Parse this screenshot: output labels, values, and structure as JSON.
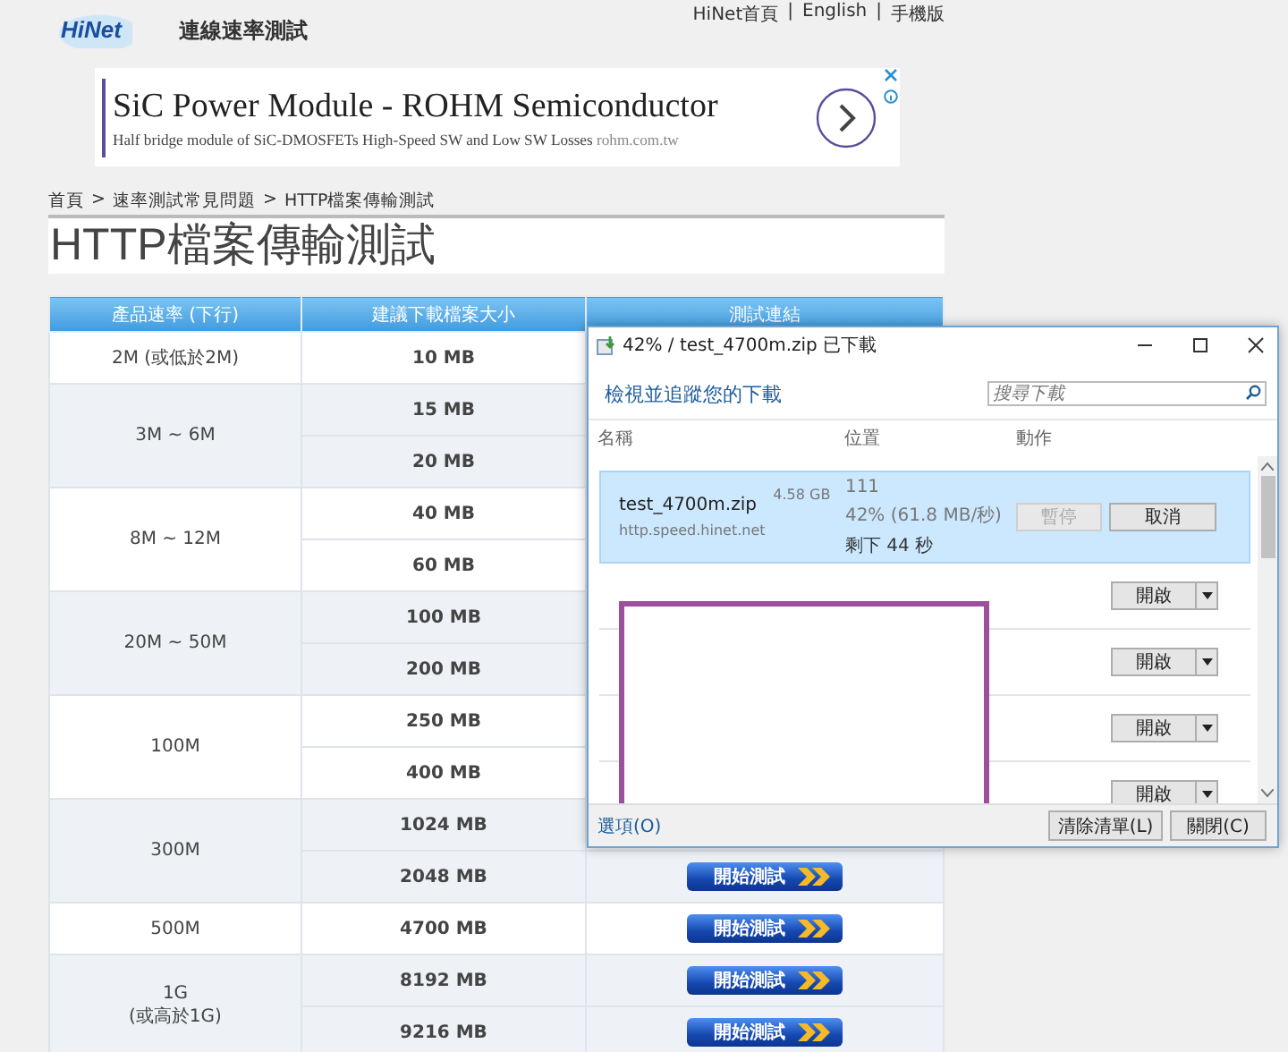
{
  "header": {
    "logo": "HiNet",
    "title": "連線速率測試",
    "links": [
      "HiNet首頁",
      "English",
      "手機版"
    ],
    "separator": "|"
  },
  "ad": {
    "title": "SiC Power Module - ROHM Semiconductor",
    "description": "Half bridge module of SiC-DMOSFETs High-Speed SW and Low SW Losses",
    "domain": "rohm.com.tw"
  },
  "breadcrumb": {
    "items": [
      "首頁",
      "速率測試常見問題",
      "HTTP檔案傳輸測試"
    ],
    "separator": ">"
  },
  "page_title": "HTTP檔案傳輸測試",
  "table": {
    "columns": [
      "產品速率 (下行)",
      "建議下載檔案大小",
      "測試連結"
    ],
    "groups": [
      {
        "speed": "2M (或低於2M)",
        "sizes": [
          {
            "size": "10 MB"
          }
        ]
      },
      {
        "speed": "3M ~ 6M",
        "sizes": [
          {
            "size": "15 MB"
          },
          {
            "size": "20 MB"
          }
        ]
      },
      {
        "speed": "8M ~ 12M",
        "sizes": [
          {
            "size": "40 MB"
          },
          {
            "size": "60 MB"
          }
        ]
      },
      {
        "speed": "20M ~ 50M",
        "sizes": [
          {
            "size": "100 MB"
          },
          {
            "size": "200 MB"
          }
        ]
      },
      {
        "speed": "100M",
        "sizes": [
          {
            "size": "250 MB"
          },
          {
            "size": "400 MB"
          }
        ]
      },
      {
        "speed": "300M",
        "sizes": [
          {
            "size": "1024 MB"
          },
          {
            "size": "2048 MB",
            "button": "開始測試"
          }
        ]
      },
      {
        "speed": "500M",
        "sizes": [
          {
            "size": "4700 MB",
            "button": "開始測試"
          }
        ]
      },
      {
        "speed": "1G\n(或高於1G)",
        "sizes": [
          {
            "size": "8192 MB",
            "button": "開始測試"
          },
          {
            "size": "9216 MB",
            "button": "開始測試"
          }
        ]
      }
    ]
  },
  "download_dialog": {
    "title": "42% / test_4700m.zip 已下載",
    "heading": "檢視並追蹤您的下載",
    "search": {
      "placeholder": "搜尋下載"
    },
    "columns": [
      "名稱",
      "位置",
      "動作"
    ],
    "items": [
      {
        "kind": "active",
        "selected": true,
        "name": "test_4700m.zip",
        "size": "4.58 GB",
        "source": "http.speed.hinet.net",
        "location": "111",
        "progress": "42% (61.8 MB/秒)",
        "remaining": "剩下 44 秒",
        "buttons": [
          {
            "label": "暫停",
            "disabled": true
          },
          {
            "label": "取消",
            "disabled": false
          }
        ]
      },
      {
        "kind": "finished",
        "selected": false,
        "button": "開啟"
      },
      {
        "kind": "finished",
        "selected": false,
        "button": "開啟"
      },
      {
        "kind": "finished",
        "selected": false,
        "button": "開啟"
      },
      {
        "kind": "finished",
        "selected": false,
        "button": "開啟"
      }
    ],
    "options_link": "選項(O)",
    "buttons": [
      "清除清單(L)",
      "關閉(C)"
    ]
  }
}
